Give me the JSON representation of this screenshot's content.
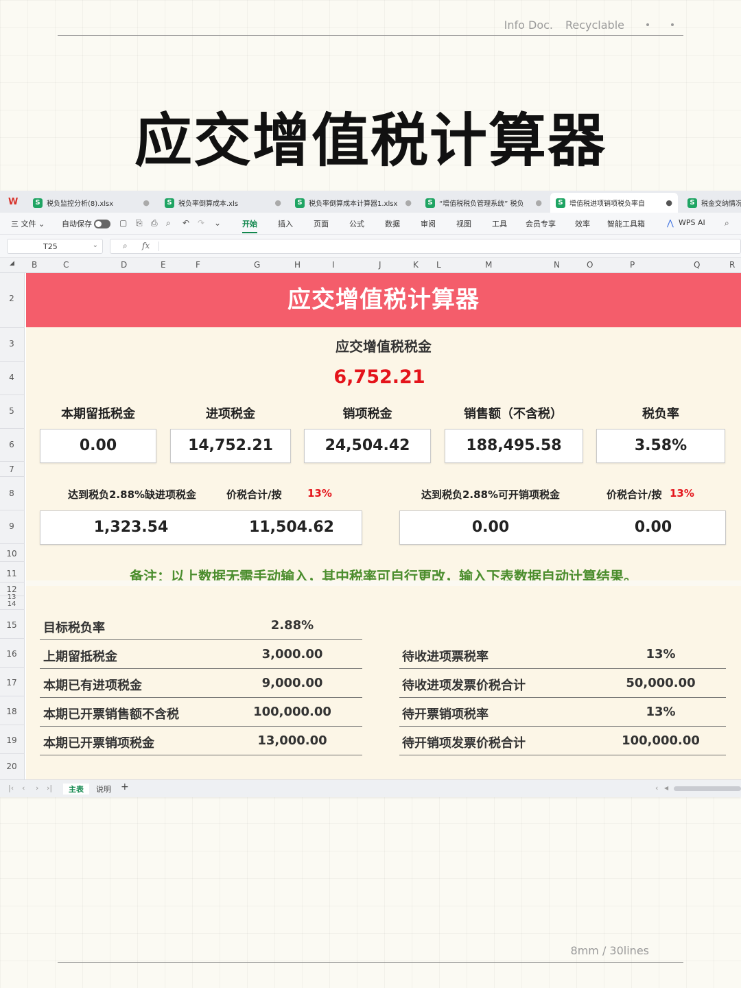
{
  "page": {
    "meta_top": [
      "Info Doc.",
      "Recyclable"
    ],
    "title": "应交增值税计算器",
    "meta_bottom": "8mm / 30lines"
  },
  "window": {
    "logo": "W",
    "tabs": [
      {
        "name": "税负监控分析(8).xlsx",
        "active": false
      },
      {
        "name": "税负率倒算成本.xls",
        "active": false
      },
      {
        "name": "税负率倒算成本计算器1.xlsx",
        "active": false
      },
      {
        "name": "“增值税税负管理系统” 税负",
        "active": false
      },
      {
        "name": "增值税进项销项税负率自",
        "active": true
      },
      {
        "name": "税金交纳情况",
        "active": false
      }
    ],
    "menu": {
      "file": "三 文件 ⌄",
      "autosave": "自动保存",
      "items": [
        "开始",
        "插入",
        "页面",
        "公式",
        "数据",
        "审阅",
        "视图",
        "工具",
        "会员专享",
        "效率",
        "智能工具箱",
        "WPS AI"
      ],
      "active_item": "开始"
    },
    "namebox": "T25",
    "fx": "fx",
    "columns": [
      "B",
      "C",
      "D",
      "E",
      "F",
      "G",
      "H",
      "I",
      "J",
      "K",
      "L",
      "M",
      "N",
      "O",
      "P",
      "Q",
      "R"
    ],
    "rows": [
      "2",
      "3",
      "4",
      "5",
      "6",
      "7",
      "8",
      "9",
      "10",
      "11",
      "12",
      "13",
      "14",
      "15",
      "16",
      "17",
      "18",
      "19",
      "20"
    ],
    "sheets": [
      "主表",
      "说明"
    ],
    "add_sheet": "+"
  },
  "calculator": {
    "banner": "应交增值税计算器",
    "payable_label": "应交增值税税金",
    "payable_value": "6,752.21",
    "summary": [
      {
        "label": "本期留抵税金",
        "value": "0.00"
      },
      {
        "label": "进项税金",
        "value": "14,752.21"
      },
      {
        "label": "销项税金",
        "value": "24,504.42"
      },
      {
        "label": "销售额（不含税）",
        "value": "188,495.58"
      },
      {
        "label": "税负率",
        "value": "3.58%"
      }
    ],
    "gap_left": {
      "label": "达到税负2.88%缺进项税金",
      "price_label": "价税合计/按",
      "rate": "13%",
      "value": "1,323.54",
      "price_value": "11,504.62"
    },
    "gap_right": {
      "label": "达到税负2.88%可开销项税金",
      "price_label": "价税合计/按",
      "rate": "13%",
      "value": "0.00",
      "price_value": "0.00"
    },
    "note": "备注：以上数据无需手动输入，其中税率可自行更改，输入下表数据自动计算结果。",
    "inputs_left": [
      {
        "label": "目标税负率",
        "value": "2.88%"
      },
      {
        "label": "上期留抵税金",
        "value": "3,000.00"
      },
      {
        "label": "本期已有进项税金",
        "value": "9,000.00"
      },
      {
        "label": "本期已开票销售额不含税",
        "value": "100,000.00"
      },
      {
        "label": "本期已开票销项税金",
        "value": "13,000.00"
      }
    ],
    "inputs_right": [
      {
        "label": "待收进项票税率",
        "value": "13%"
      },
      {
        "label": "待收进项发票价税合计",
        "value": "50,000.00"
      },
      {
        "label": "待开票销项税率",
        "value": "13%"
      },
      {
        "label": "待开销项发票价税合计",
        "value": "100,000.00"
      }
    ]
  },
  "colors": {
    "banner": "#f45d6b",
    "result_red": "#e4141b",
    "note_green": "#4b8d2d",
    "active_menu": "#11874d",
    "calc_bg": "#fcf6e7"
  }
}
